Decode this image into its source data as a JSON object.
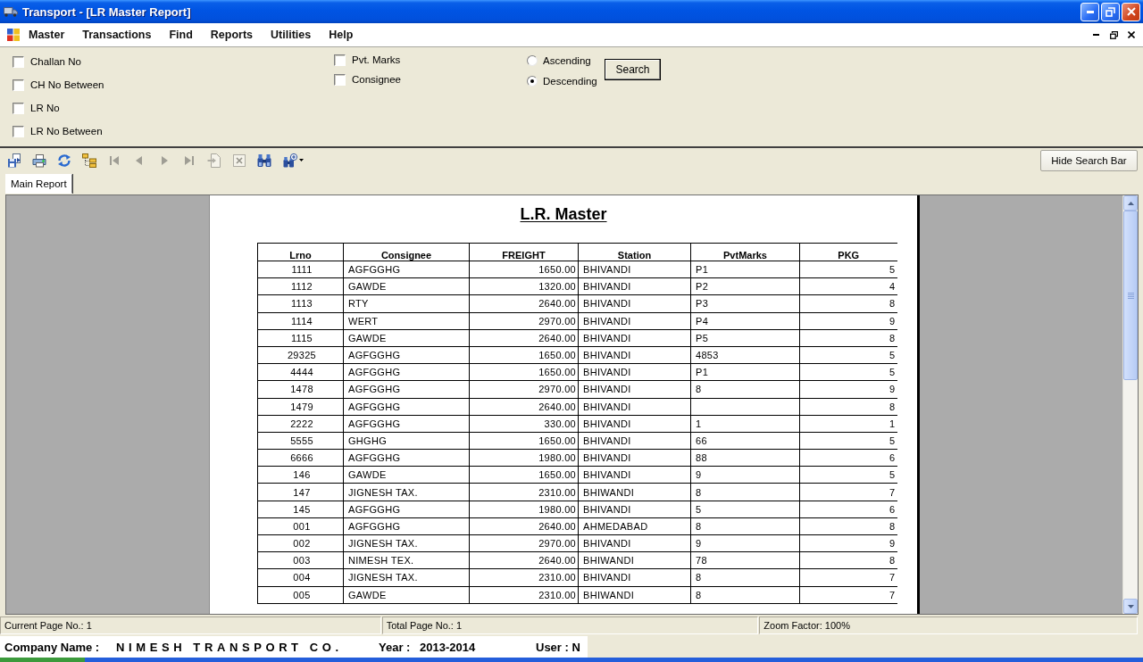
{
  "window": {
    "title": "Transport - [LR Master Report]"
  },
  "menu": {
    "items": [
      "Master",
      "Transactions",
      "Find",
      "Reports",
      "Utilities",
      "Help"
    ]
  },
  "search_panel": {
    "filter_columns": [
      {
        "filters": [
          {
            "label": "Challan No",
            "checked": false
          },
          {
            "label": "CH No Between",
            "checked": false
          },
          {
            "label": "LR No",
            "checked": false
          },
          {
            "label": "LR No Between",
            "checked": false
          }
        ]
      },
      {
        "filters": [
          {
            "label": "Pvt. Marks",
            "checked": false
          },
          {
            "label": "Consignee",
            "checked": false
          }
        ]
      }
    ],
    "sort_options": [
      {
        "label": "Ascending",
        "selected": false
      },
      {
        "label": "Descending",
        "selected": true
      }
    ],
    "search_button": "Search"
  },
  "toolbar": {
    "buttons": [
      {
        "kind": "export",
        "disabled": false
      },
      {
        "kind": "print",
        "disabled": false
      },
      {
        "kind": "refresh",
        "disabled": false
      },
      {
        "kind": "tree",
        "disabled": false
      },
      {
        "kind": "first",
        "disabled": true
      },
      {
        "kind": "previous",
        "disabled": true
      },
      {
        "kind": "next",
        "disabled": true
      },
      {
        "kind": "last",
        "disabled": true
      },
      {
        "kind": "goto",
        "disabled": true
      },
      {
        "kind": "stop",
        "disabled": true
      },
      {
        "kind": "find",
        "disabled": false
      },
      {
        "kind": "zoom",
        "disabled": false
      }
    ],
    "hide_button": "Hide Search Bar"
  },
  "tabs": [
    {
      "label": "Main Report",
      "selected": true
    }
  ],
  "report": {
    "title": "L.R. Master",
    "columns": [
      "Lrno",
      "Consignee",
      "FREIGHT",
      "Station",
      "PvtMarks",
      "PKG"
    ],
    "rows": [
      {
        "lrno": "1111",
        "consignee": "AGFGGHG",
        "freight": "1650.00",
        "station": "BHIVANDI",
        "pvt_marks": "P1",
        "pkg": "5"
      },
      {
        "lrno": "1112",
        "consignee": "GAWDE",
        "freight": "1320.00",
        "station": "BHIVANDI",
        "pvt_marks": "P2",
        "pkg": "4"
      },
      {
        "lrno": "1113",
        "consignee": "RTY",
        "freight": "2640.00",
        "station": "BHIVANDI",
        "pvt_marks": "P3",
        "pkg": "8"
      },
      {
        "lrno": "1114",
        "consignee": "WERT",
        "freight": "2970.00",
        "station": "BHIVANDI",
        "pvt_marks": "P4",
        "pkg": "9"
      },
      {
        "lrno": "1115",
        "consignee": "GAWDE",
        "freight": "2640.00",
        "station": "BHIVANDI",
        "pvt_marks": "P5",
        "pkg": "8"
      },
      {
        "lrno": "29325",
        "consignee": "AGFGGHG",
        "freight": "1650.00",
        "station": "BHIVANDI",
        "pvt_marks": "4853",
        "pkg": "5"
      },
      {
        "lrno": "4444",
        "consignee": "AGFGGHG",
        "freight": "1650.00",
        "station": "BHIVANDI",
        "pvt_marks": "P1",
        "pkg": "5"
      },
      {
        "lrno": "1478",
        "consignee": "AGFGGHG",
        "freight": "2970.00",
        "station": "BHIVANDI",
        "pvt_marks": "8",
        "pkg": "9"
      },
      {
        "lrno": "1479",
        "consignee": "AGFGGHG",
        "freight": "2640.00",
        "station": "BHIVANDI",
        "pkg": "8"
      },
      {
        "lrno": "2222",
        "consignee": "AGFGGHG",
        "freight": "330.00",
        "station": "BHIVANDI",
        "pvt_marks": "1",
        "pkg": "1"
      },
      {
        "lrno": "5555",
        "consignee": "GHGHG",
        "freight": "1650.00",
        "station": "BHIVANDI",
        "pvt_marks": "66",
        "pkg": "5"
      },
      {
        "lrno": "6666",
        "consignee": "AGFGGHG",
        "freight": "1980.00",
        "station": "BHIVANDI",
        "pvt_marks": "88",
        "pkg": "6"
      },
      {
        "lrno": "146",
        "consignee": "GAWDE",
        "freight": "1650.00",
        "station": "BHIVANDI",
        "pvt_marks": "9",
        "pkg": "5"
      },
      {
        "lrno": "147",
        "consignee": "JIGNESH TAX.",
        "freight": "2310.00",
        "station": "BHIWANDI",
        "pvt_marks": "8",
        "pkg": "7"
      },
      {
        "lrno": "145",
        "consignee": "AGFGGHG",
        "freight": "1980.00",
        "station": "BHIVANDI",
        "pvt_marks": "5",
        "pkg": "6"
      },
      {
        "lrno": "001",
        "consignee": "AGFGGHG",
        "freight": "2640.00",
        "station": "AHMEDABAD",
        "pvt_marks": "8",
        "pkg": "8"
      },
      {
        "lrno": "002",
        "consignee": "JIGNESH TAX.",
        "freight": "2970.00",
        "station": "BHIVANDI",
        "pvt_marks": "9",
        "pkg": "9"
      },
      {
        "lrno": "003",
        "consignee": "NIMESH TEX.",
        "freight": "2640.00",
        "station": "BHIWANDI",
        "pvt_marks": "78",
        "pkg": "8"
      },
      {
        "lrno": "004",
        "consignee": "JIGNESH TAX.",
        "freight": "2310.00",
        "station": "BHIVANDI",
        "pvt_marks": "8",
        "pkg": "7"
      },
      {
        "lrno": "005",
        "consignee": "GAWDE",
        "freight": "2310.00",
        "station": "BHIWANDI",
        "pvt_marks": "8",
        "pkg": "7"
      }
    ]
  },
  "status_bar": {
    "current_page": "Current Page No.: 1",
    "total_pages": "Total Page No.: 1",
    "zoom": "Zoom Factor: 100%"
  },
  "footer": {
    "company_label": "Company Name :",
    "company": "NIMESH TRANSPORT CO.",
    "year_label": "Year :",
    "year": "2013-2014",
    "user": "User : N"
  }
}
